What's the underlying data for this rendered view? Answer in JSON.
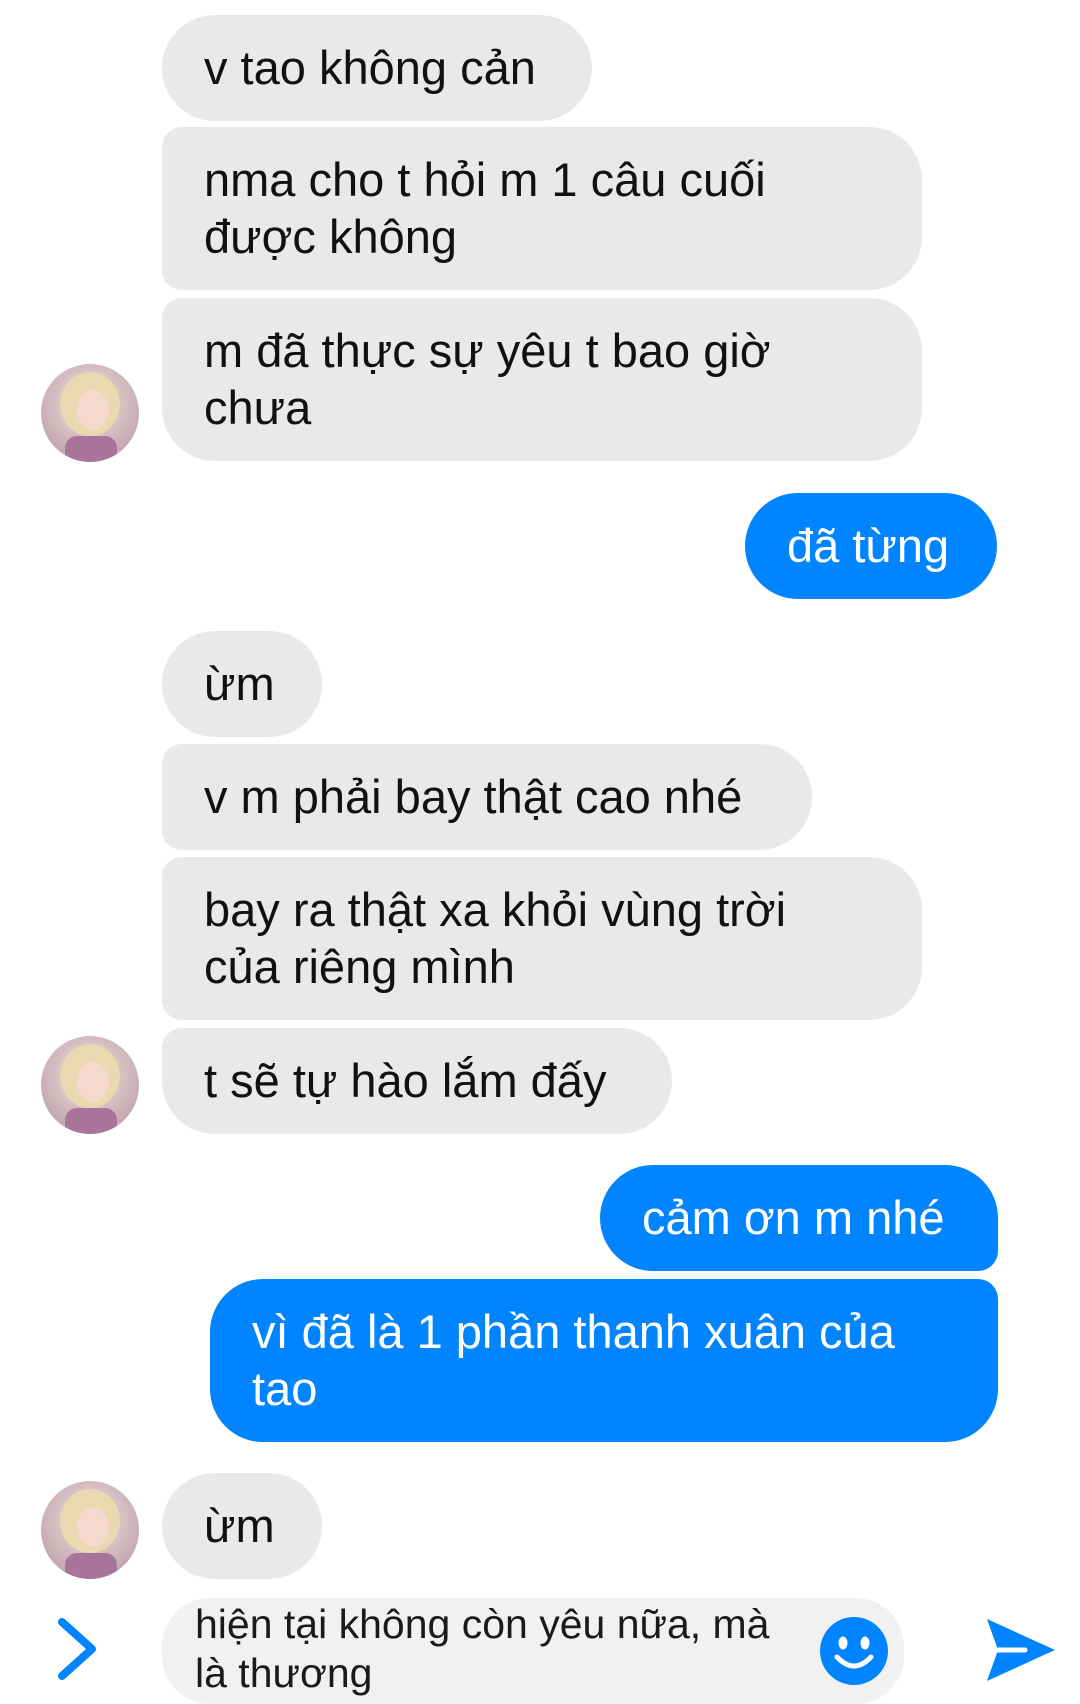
{
  "colors": {
    "incoming_bubble": "#e9e9e9",
    "outgoing_bubble": "#0084ff",
    "accent": "#0084ff"
  },
  "messages": [
    {
      "sender": "them",
      "text": "v tao không cản"
    },
    {
      "sender": "them",
      "text": "nma cho t hỏi m 1 câu cuối\nđược không"
    },
    {
      "sender": "them",
      "text": "m đã thực sự yêu t bao giờ\nchưa"
    },
    {
      "sender": "me",
      "text": "đã từng"
    },
    {
      "sender": "them",
      "text": "ừm"
    },
    {
      "sender": "them",
      "text": "v m phải bay thật cao nhé"
    },
    {
      "sender": "them",
      "text": "bay ra thật xa khỏi vùng trời\ncủa riêng mình"
    },
    {
      "sender": "them",
      "text": "t sẽ tự hào lắm đấy"
    },
    {
      "sender": "me",
      "text": "cảm ơn m nhé"
    },
    {
      "sender": "me",
      "text": "vì đã là 1 phần thanh xuân của\ntao"
    },
    {
      "sender": "them",
      "text": "ừm"
    }
  ],
  "composer": {
    "text": "hiện tại không còn yêu nữa, mà\nlà thương",
    "expand_icon": "chevron-right-icon",
    "emoji_icon": "smiley-icon",
    "send_icon": "send-icon"
  }
}
